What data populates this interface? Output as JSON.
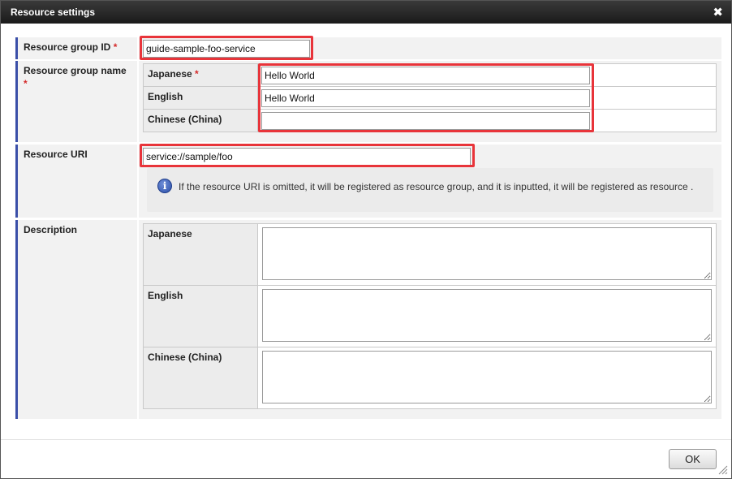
{
  "dialog": {
    "title": "Resource settings",
    "close_glyph": "✖"
  },
  "resource_group_id": {
    "label": "Resource group ID",
    "required_mark": "*",
    "value": "guide-sample-foo-service"
  },
  "resource_group_name": {
    "label": "Resource group name",
    "required_mark": "*",
    "rows": [
      {
        "lang": "Japanese",
        "required_mark": "*",
        "value": "Hello World"
      },
      {
        "lang": "English",
        "value": "Hello World"
      },
      {
        "lang": "Chinese (China)",
        "value": ""
      }
    ]
  },
  "resource_uri": {
    "label": "Resource URI",
    "value": "service://sample/foo",
    "info_icon": "info-circle-icon",
    "info_text": "If the resource URI is omitted, it will be registered as resource group, and it is inputted, it will be registered as resource ."
  },
  "description": {
    "label": "Description",
    "rows": [
      {
        "lang": "Japanese",
        "value": ""
      },
      {
        "lang": "English",
        "value": ""
      },
      {
        "lang": "Chinese (China)",
        "value": ""
      }
    ]
  },
  "footer": {
    "ok_label": "OK"
  },
  "colors": {
    "accent_bar": "#3a4fa8",
    "highlight_frame": "#e8343a",
    "required": "#d42a2a",
    "titlebar": "#262626"
  }
}
